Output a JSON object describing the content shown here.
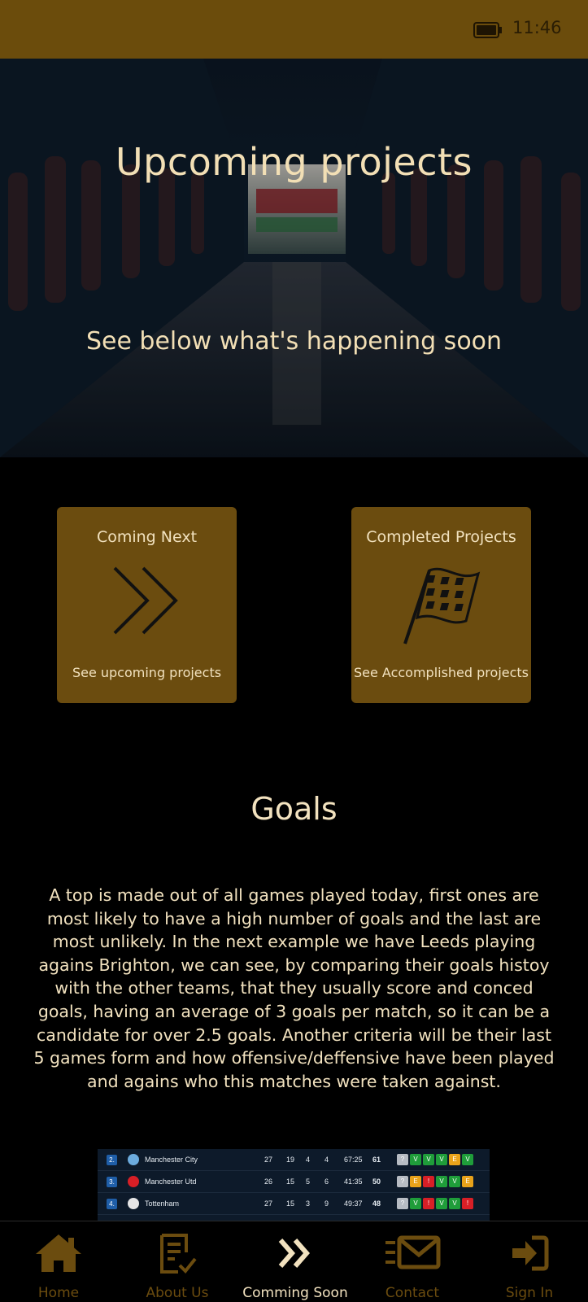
{
  "status_bar": {
    "time": "11:46",
    "battery_icon": "battery-icon"
  },
  "hero": {
    "title": "Upcoming projects",
    "subtitle": "See below what's happening soon"
  },
  "cards": [
    {
      "title": "Coming Next",
      "subtitle": "See upcoming projects",
      "icon": "double-chevron-right-icon"
    },
    {
      "title": "Completed Projects",
      "subtitle": "See Accomplished projects",
      "icon": "checkered-flag-icon"
    }
  ],
  "goals": {
    "title": "Goals",
    "text": "A top is made out of all games played today, first ones are most likely to have a high number of goals and the last are most unlikely. In the next example we have Leeds playing agains Brighton, we can see, by comparing their goals histoy with the other teams, that they usually score and conced goals, having an average of 3 goals per match, so it can be a candidate for over 2.5 goals. Another criteria will be their last 5 games form and how offensive/deffensive have been played and agains who this matches were taken against."
  },
  "standings": {
    "rows": [
      {
        "rank": "2.",
        "team": "Manchester City",
        "played": "27",
        "won": "19",
        "drawn": "4",
        "lost": "4",
        "goals": "67:25",
        "points": "61",
        "form": [
          "?",
          "V",
          "V",
          "V",
          "E",
          "V"
        ]
      },
      {
        "rank": "3.",
        "team": "Manchester Utd",
        "played": "26",
        "won": "15",
        "drawn": "5",
        "lost": "6",
        "goals": "41:35",
        "points": "50",
        "form": [
          "?",
          "E",
          "!",
          "V",
          "V",
          "E"
        ]
      },
      {
        "rank": "4.",
        "team": "Tottenham",
        "played": "27",
        "won": "15",
        "drawn": "3",
        "lost": "9",
        "goals": "49:37",
        "points": "48",
        "form": [
          "?",
          "V",
          "!",
          "V",
          "V",
          "!"
        ]
      }
    ]
  },
  "nav": {
    "items": [
      {
        "label": "Home",
        "icon": "home-icon",
        "active": false
      },
      {
        "label": "About Us",
        "icon": "document-check-icon",
        "active": false
      },
      {
        "label": "Comming Soon",
        "icon": "double-chevron-right-icon",
        "active": true
      },
      {
        "label": "Contact",
        "icon": "envelope-icon",
        "active": false
      },
      {
        "label": "Sign In",
        "icon": "sign-in-icon",
        "active": false
      }
    ]
  },
  "colors": {
    "accent": "#6b4c0f",
    "text": "#f2e2bf",
    "background": "#000000"
  }
}
